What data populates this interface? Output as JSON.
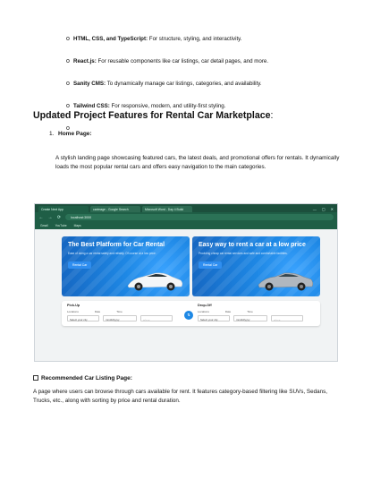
{
  "bullets": [
    {
      "bold": "HTML, CSS, and TypeScript:",
      "text": " For structure, styling, and interactivity."
    },
    {
      "bold": "React.js:",
      "text": " For reusable components like car listings, car detail pages, and more."
    },
    {
      "bold": "Sanity CMS:",
      "text": " To dynamically manage car listings, categories, and availability."
    },
    {
      "bold": "Tailwind CSS:",
      "text": " For responsive, modern, and utility-first styling."
    },
    {
      "bold": "",
      "text": ""
    }
  ],
  "bullet_glyph": "o",
  "heading": {
    "text": "Updated Project Features for Rental Car Marketplace",
    "colon": ":"
  },
  "item1": {
    "number": "1.",
    "label": "Home Page:"
  },
  "paragraph1": "A stylish landing page showcasing featured cars, the latest deals, and promotional offers for rentals. It dynamically loads the most popular rental cars and offers easy navigation to the main categories.",
  "screenshot": {
    "tabs": [
      "Create Next App",
      "carimage - Google Search",
      "Microsoft Word - Day 4 Build"
    ],
    "window_controls": [
      "—",
      "▢",
      "✕"
    ],
    "nav": [
      "←",
      "→",
      "⟳"
    ],
    "url": "localhost:3000",
    "bookmarks": [
      "Gmail",
      "YouTube",
      "Maps"
    ],
    "banner_left": {
      "title": "The Best Platform for Car Rental",
      "subtitle": "Ease of doing a car rental safely and reliably. Of course at a low price.",
      "button": "Rental Car"
    },
    "banner_right": {
      "title": "Easy way to rent a car at a low price",
      "subtitle": "Providing cheap car rental services and safe and comfortable facilities.",
      "button": "Rental Car"
    },
    "pickup": {
      "title": "Pick-Up",
      "labels": [
        "Locations",
        "Date",
        "Time"
      ],
      "fields": [
        "Select your city",
        "mm/dd/yyyy",
        "--:-- --"
      ]
    },
    "dropoff": {
      "title": "Drop-Off",
      "labels": [
        "Locations",
        "Date",
        "Time"
      ],
      "fields": [
        "Select your city",
        "mm/dd/yyyy",
        "--:-- --"
      ]
    },
    "swap_icon": "⇅"
  },
  "item2": {
    "label": "Recommended Car Listing Page:"
  },
  "paragraph2": "A page where users can browse through cars available for rent. It features category-based filtering like SUVs, Sedans, Trucks, etc., along with sorting by price and rental duration."
}
